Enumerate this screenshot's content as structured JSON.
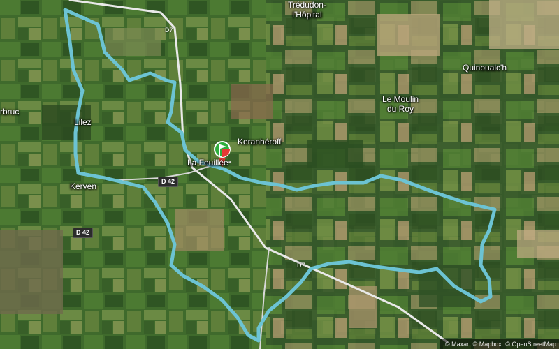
{
  "places": [
    {
      "name": "Trédudon-\nl'Hôpital",
      "line1": "Trédudon-",
      "line2": "l'Hôpital"
    },
    {
      "name": "Quinoualc'h"
    },
    {
      "name": "Le Moulin du Roy",
      "line1": "Le Moulin",
      "line2": "du Roy"
    },
    {
      "name": "Keranhéroff"
    },
    {
      "name": "La Feuillée"
    },
    {
      "name": "rbruc"
    },
    {
      "name": "Lilez"
    },
    {
      "name": "Kerven"
    }
  ],
  "roads": {
    "d42_a": "D 42",
    "d42_b": "D 42",
    "d7_top": "D7",
    "d7_mid": "D7"
  },
  "attribution": {
    "maxar": "© Maxar",
    "mapbox": "© Mapbox",
    "osm": "© OpenStreetMap"
  },
  "colors": {
    "route": "#6cc3d3",
    "road": "#e9e9e9",
    "marker_green": "#2fae3d",
    "marker_red": "#e53935"
  }
}
